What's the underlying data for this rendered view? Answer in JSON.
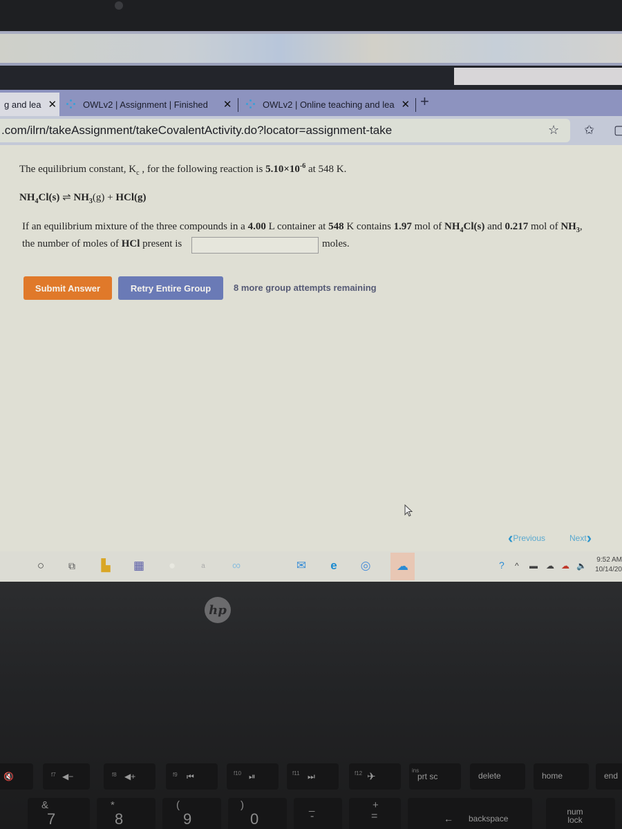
{
  "browser": {
    "tabs": [
      {
        "title": "g and lea",
        "active": true
      },
      {
        "title": "OWLv2 | Assignment | Finished",
        "active": false
      },
      {
        "title": "OWLv2 | Online teaching and lea",
        "active": false
      }
    ],
    "close_glyph": "✕",
    "new_tab_glyph": "+",
    "url": ".com/ilrn/takeAssignment/takeCovalentActivity.do?locator=assignment-take",
    "icons": [
      "add-favorite-icon",
      "favorites-icon",
      "collections-icon"
    ]
  },
  "question": {
    "intro_prefix": "The equilibrium constant, K",
    "intro_k_sub": "c",
    "intro_mid": " , for the following reaction is ",
    "k_value_base": "5.10×10",
    "k_value_exp": "-6",
    "intro_temp": " at 548 K.",
    "reaction": {
      "reactant_a": "NH",
      "reactant_a_sub": "4",
      "reactant_b": "Cl(s)",
      "arrow": "⇌",
      "product1_a": "NH",
      "product1_sub": "3",
      "product1_b": "(g) + ",
      "product2": "HCl(g)"
    },
    "line3": {
      "t1": "If an equilibrium mixture of the three compounds in a ",
      "volume": "4.00",
      "t2": " L container at ",
      "temp": "548",
      "t3": " K contains ",
      "mol1": "1.97",
      "t4": " mol of ",
      "s1a": "NH",
      "s1sub": "4",
      "s1b": "Cl(s)",
      "t5": " and ",
      "mol2": "0.217",
      "t6": " mol of ",
      "s2a": "NH",
      "s2sub": "3",
      "t7": ","
    },
    "line4_prefix": "the number of moles of ",
    "line4_bold": "HCl",
    "line4_suffix": " present is",
    "answer_value": "",
    "unit": "moles."
  },
  "actions": {
    "submit_label": "Submit Answer",
    "retry_label": "Retry Entire Group",
    "attempts_text": "8 more group attempts remaining",
    "previous_label": "Previous",
    "next_label": "Next"
  },
  "colors": {
    "submit": "#e0792a",
    "retry": "#6a7ab6",
    "nav_link": "#2e95cc"
  },
  "taskbar": {
    "apps": [
      "search-icon",
      "task-view-icon",
      "file-explorer-icon",
      "store-icon",
      "app-icon",
      "app-icon",
      "copilot-icon",
      "mail-icon",
      "edge-icon",
      "edge-beta-icon",
      "onedrive-icon"
    ],
    "clock_time": "9:52 AM",
    "clock_date": "10/14/20"
  },
  "laptop": {
    "logo": "hp",
    "fn_keys": [
      {
        "fn": "",
        "label": "mute"
      },
      {
        "fn": "f7",
        "label": "vol-"
      },
      {
        "fn": "f8",
        "label": "vol+"
      },
      {
        "fn": "f9",
        "label": "prev"
      },
      {
        "fn": "f10",
        "label": "play"
      },
      {
        "fn": "f11",
        "label": "next"
      },
      {
        "fn": "f12",
        "label": "airplane"
      },
      {
        "fn": "ins",
        "label": "prt sc"
      },
      {
        "fn": "",
        "label": "delete"
      },
      {
        "fn": "",
        "label": "home"
      },
      {
        "fn": "",
        "label": "end"
      }
    ],
    "fn_glyphs": [
      "🔇",
      "◀−",
      "◀+",
      "⏮",
      "⏯",
      "⏭",
      "✈"
    ],
    "number_keys": [
      {
        "top": "&",
        "main": "7"
      },
      {
        "top": "*",
        "main": "8"
      },
      {
        "top": "(",
        "main": "9"
      },
      {
        "top": ")",
        "main": "0"
      },
      {
        "top": "_",
        "main": "-"
      },
      {
        "top": "+",
        "main": "="
      }
    ],
    "backspace_label": "backspace",
    "backspace_arrow": "←",
    "numlock_label": "num lock"
  }
}
